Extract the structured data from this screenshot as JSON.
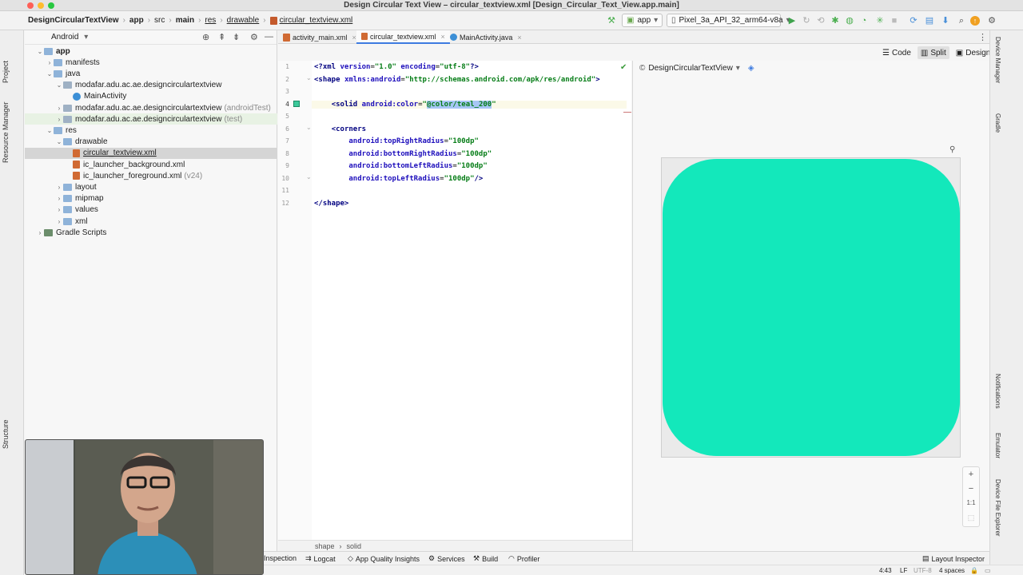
{
  "window": {
    "title": "Design Circular Text View – circular_textview.xml [Design_Circular_Text_View.app.main]"
  },
  "breadcrumb": [
    "DesignCircularTextView",
    "app",
    "src",
    "main",
    "res",
    "drawable",
    "circular_textview.xml"
  ],
  "toolbar": {
    "run_config": "app",
    "device": "Pixel_3a_API_32_arm64-v8a"
  },
  "left_strip": {
    "project": "Project",
    "resource_manager": "Resource Manager",
    "structure": "Structure"
  },
  "project_panel": {
    "view_mode": "Android",
    "tree": [
      {
        "label": "app",
        "indent": 0,
        "arrow": "▾",
        "icon": "folder"
      },
      {
        "label": "manifests",
        "indent": 1,
        "arrow": "▸",
        "icon": "folder"
      },
      {
        "label": "java",
        "indent": 1,
        "arrow": "▾",
        "icon": "folder"
      },
      {
        "label": "modafar.adu.ac.ae.designcirculartextview",
        "indent": 2,
        "arrow": "▾",
        "icon": "pkg"
      },
      {
        "label": "MainActivity",
        "indent": 3,
        "arrow": "",
        "icon": "java"
      },
      {
        "label": "modafar.adu.ac.ae.designcirculartextview",
        "suffix": "(androidTest)",
        "indent": 2,
        "arrow": "▸",
        "icon": "pkg"
      },
      {
        "label": "modafar.adu.ac.ae.designcirculartextview",
        "suffix": "(test)",
        "indent": 2,
        "arrow": "▸",
        "icon": "pkg"
      },
      {
        "label": "res",
        "indent": 1,
        "arrow": "▾",
        "icon": "res"
      },
      {
        "label": "drawable",
        "indent": 2,
        "arrow": "▾",
        "icon": "folder"
      },
      {
        "label": "circular_textview.xml",
        "indent": 3,
        "arrow": "",
        "icon": "xml"
      },
      {
        "label": "ic_launcher_background.xml",
        "indent": 3,
        "arrow": "",
        "icon": "xml"
      },
      {
        "label": "ic_launcher_foreground.xml",
        "suffix": "(v24)",
        "indent": 3,
        "arrow": "",
        "icon": "xml"
      },
      {
        "label": "layout",
        "indent": 2,
        "arrow": "▸",
        "icon": "folder"
      },
      {
        "label": "mipmap",
        "indent": 2,
        "arrow": "▸",
        "icon": "folder"
      },
      {
        "label": "values",
        "indent": 2,
        "arrow": "▸",
        "icon": "folder"
      },
      {
        "label": "xml",
        "indent": 2,
        "arrow": "▸",
        "icon": "folder"
      },
      {
        "label": "Gradle Scripts",
        "indent": 0,
        "arrow": "▸",
        "icon": "gradle"
      }
    ]
  },
  "editor_tabs": [
    {
      "label": "activity_main.xml"
    },
    {
      "label": "circular_textview.xml"
    },
    {
      "label": "MainActivity.java"
    }
  ],
  "view_modes": [
    "Code",
    "Split",
    "Design"
  ],
  "code_lines": [
    {
      "n": "1",
      "html": "<span class='tag'>&lt;?xml</span> <span class='attr'>version</span>=<span class='str'>\"1.0\"</span> <span class='attr'>encoding</span>=<span class='str'>\"utf-8\"</span><span class='tag'>?&gt;</span>"
    },
    {
      "n": "2",
      "html": "<span class='tag'>&lt;shape</span> <span class='attr'>xmlns:android</span>=<span class='str'>\"http://schemas.android.com/apk/res/android\"</span><span class='tag'>&gt;</span>"
    },
    {
      "n": "3",
      "html": ""
    },
    {
      "n": "4",
      "html": "    <span class='tag'>&lt;solid</span> <span class='attr'>android:color</span>=<span class='str'>\"<span class='sel'>@color/teal_200</span>\"</span>"
    },
    {
      "n": "5",
      "html": ""
    },
    {
      "n": "6",
      "html": "    <span class='tag'>&lt;corners</span>"
    },
    {
      "n": "7",
      "html": "        <span class='attr'>android:topRightRadius</span>=<span class='str'>\"100dp\"</span>"
    },
    {
      "n": "8",
      "html": "        <span class='attr'>android:bottomRightRadius</span>=<span class='str'>\"100dp\"</span>"
    },
    {
      "n": "9",
      "html": "        <span class='attr'>android:bottomLeftRadius</span>=<span class='str'>\"100dp\"</span>"
    },
    {
      "n": "10",
      "html": "        <span class='attr'>android:topLeftRadius</span>=<span class='str'>\"100dp\"</span><span class='tag'>/&gt;</span>"
    },
    {
      "n": "11",
      "html": ""
    },
    {
      "n": "12",
      "html": "<span class='tag'>&lt;/shape&gt;</span>"
    }
  ],
  "editor_breadcrumb": [
    "shape",
    "solid"
  ],
  "design": {
    "component_name": "DesignCircularTextView",
    "shape_color": "#13e8bb",
    "zoom_actual": "1:1"
  },
  "right_strip": {
    "device_manager": "Device Manager",
    "gradle": "Gradle",
    "notifications": "Notifications",
    "emulator": "Emulator",
    "device_file_explorer": "Device File Explorer"
  },
  "bottom_tools": [
    "Inspection",
    "Logcat",
    "App Quality Insights",
    "Services",
    "Build",
    "Profiler",
    "Layout Inspector"
  ],
  "status": {
    "position": "4:43",
    "line_sep": "LF",
    "encoding": "UTF-8",
    "indent": "4 spaces"
  }
}
